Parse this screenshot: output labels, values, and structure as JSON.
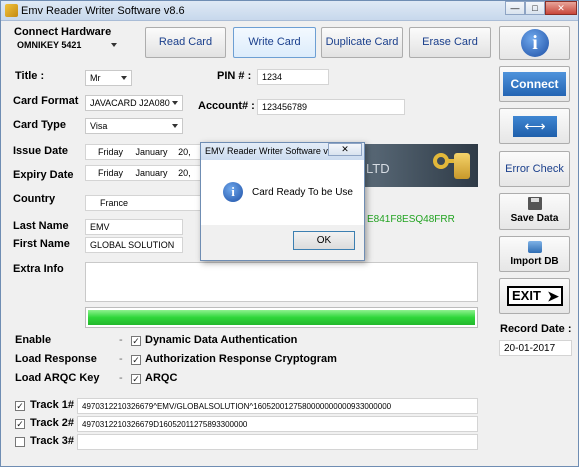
{
  "window": {
    "title": "Emv Reader Writer Software v8.6"
  },
  "hardware": {
    "label": "Connect Hardware",
    "reader": "OMNIKEY 5421"
  },
  "top_buttons": {
    "read": "Read Card",
    "write": "Write Card",
    "duplicate": "Duplicate Card",
    "erase": "Erase Card"
  },
  "form": {
    "title_label": "Title :",
    "title_value": "Mr",
    "pin_label": "PIN # :",
    "pin_value": "1234",
    "card_format_label": "Card Format",
    "card_format_value": "JAVACARD J2A080",
    "account_label": "Account# :",
    "account_value": "123456789",
    "card_type_label": "Card Type",
    "card_type_value": "Visa",
    "issue_label": "Issue Date",
    "issue_day": "Friday",
    "issue_month": "January",
    "issue_date": "20,",
    "expiry_label": "Expiry Date",
    "expiry_day": "Friday",
    "expiry_month": "January",
    "expiry_date": "20,",
    "country_label": "Country",
    "country_value": "France",
    "last_name_label": "Last Name",
    "last_name_value": "EMV",
    "first_name_label": "First Name",
    "first_name_value": "GLOBAL SOLUTION",
    "extra_label": "Extra Info",
    "banner_text": "LTD",
    "code_text": "E841F8ESQ48FRR"
  },
  "options": {
    "enable_label": "Enable",
    "enable_option": "Dynamic Data Authentication",
    "load_response_label": "Load Response",
    "load_response_option": "Authorization Response Cryptogram",
    "load_arqc_label": "Load ARQC Key",
    "load_arqc_option": "ARQC"
  },
  "tracks": {
    "t1_label": "Track 1#",
    "t1_value": "4970312210326679^EMV/GLOBALSOLUTION^1605200127580000000000933000000",
    "t2_label": "Track 2#",
    "t2_value": "4970312210326679D16052011275893300000",
    "t3_label": "Track 3#",
    "t3_value": ""
  },
  "sidebar": {
    "connect": "Connect",
    "error_check": "Error Check",
    "save_data": "Save Data",
    "import_db": "Import DB",
    "exit": "EXIT",
    "record_date_label": "Record Date :",
    "record_date_value": "20-01-2017"
  },
  "dialog": {
    "title": "EMV Reader Writer Software v...",
    "message": "Card Ready To be Use",
    "ok": "OK"
  },
  "colors": {
    "progress_green": "#2fd63a",
    "link_blue": "#1a3f8c",
    "connect_blue": "#2e76c4"
  }
}
